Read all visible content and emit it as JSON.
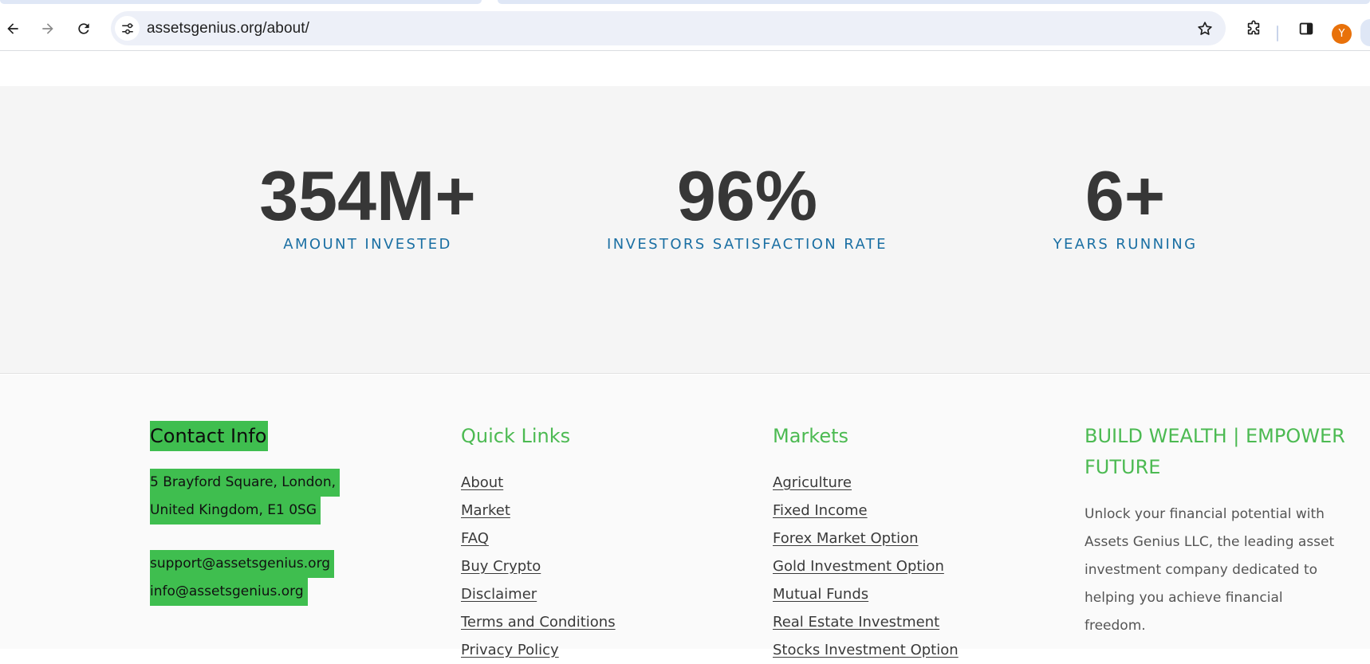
{
  "browser": {
    "url": "assetsgenius.org/about/",
    "avatar_letter": "Y"
  },
  "stats": [
    {
      "value": "354M+",
      "label": "AMOUNT INVESTED"
    },
    {
      "value": "96%",
      "label": "INVESTORS SATISFACTION RATE"
    },
    {
      "value": "6+",
      "label": "YEARS RUNNING"
    }
  ],
  "footer": {
    "contact": {
      "title": "Contact Info",
      "address_line1": "5 Brayford Square, London,",
      "address_line2": "United Kingdom, E1 0SG",
      "email_support": "support@assetsgenius.org",
      "email_info": "info@assetsgenius.org"
    },
    "quick_links": {
      "title": "Quick Links",
      "items": [
        "About",
        "Market",
        "FAQ",
        "Buy Crypto",
        "Disclaimer",
        "Terms and Conditions",
        "Privacy Policy"
      ]
    },
    "markets": {
      "title": "Markets",
      "items": [
        "Agriculture",
        "Fixed Income",
        "Forex Market Option",
        "Gold Investment Option",
        "Mutual Funds",
        "Real Estate Investment",
        "Stocks Investment Option"
      ]
    },
    "build": {
      "title": "BUILD WEALTH | EMPOWER FUTURE",
      "text": "Unlock your financial potential with Assets Genius LLC, the leading asset investment company dedicated to helping you achieve financial freedom."
    }
  },
  "colors": {
    "accent_green": "#4cba52",
    "highlight_green": "#3fbe4f",
    "stat_label_blue": "#1a6fa3",
    "stat_number": "#373737"
  }
}
